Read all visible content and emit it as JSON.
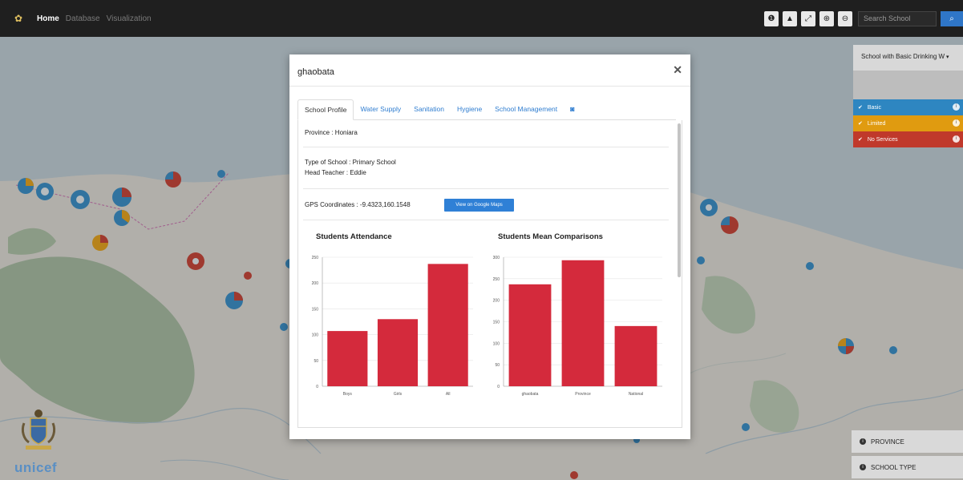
{
  "nav": {
    "links": [
      "Home",
      "Database",
      "Visualization"
    ],
    "search_placeholder": "Search School"
  },
  "legend": {
    "title": "School with Basic Drinking W",
    "items": [
      {
        "label": "Basic",
        "color": "#2e86c1"
      },
      {
        "label": "Limited",
        "color": "#e09b10"
      },
      {
        "label": "No Services",
        "color": "#c0392b"
      }
    ]
  },
  "filters": {
    "province": "PROVINCE",
    "school_type": "SCHOOL TYPE"
  },
  "branding": {
    "unicef": "unicef"
  },
  "modal": {
    "title": "ghaobata",
    "tabs": [
      "School Profile",
      "Water Supply",
      "Sanitation",
      "Hygiene",
      "School Management"
    ],
    "province": "Province : Honiara",
    "school_type": "Type of School : Primary School",
    "head_teacher": "Head Teacher : Eddie",
    "gps": "GPS Coordinates : -9.4323,160.1548",
    "gmap_button": "View on Google Maps"
  },
  "chart_data": [
    {
      "type": "bar",
      "title": "Students Attendance",
      "categories": [
        "Boys",
        "Girls",
        "All"
      ],
      "values": [
        107,
        130,
        237
      ],
      "ylim": [
        0,
        250
      ],
      "yticks": [
        0,
        50,
        100,
        150,
        200,
        250
      ],
      "color": "#d42a3c"
    },
    {
      "type": "bar",
      "title": "Students Mean Comparisons",
      "categories": [
        "ghaobata",
        "Province",
        "National"
      ],
      "values": [
        237,
        293,
        140
      ],
      "ylim": [
        0,
        300
      ],
      "yticks": [
        0,
        50,
        100,
        150,
        200,
        250,
        300
      ],
      "color": "#d42a3c"
    }
  ]
}
